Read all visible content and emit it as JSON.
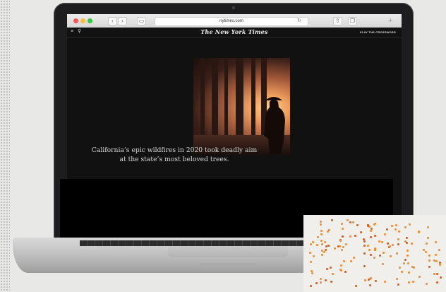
{
  "browser": {
    "url": "nytimes.com",
    "back_glyph": "‹",
    "forward_glyph": "›",
    "plus_glyph": "+",
    "reload_glyph": "↻"
  },
  "site": {
    "logo": "The New York Times",
    "right_link": "PLAY THE CROSSWORD",
    "menu_glyph": "≡",
    "search_glyph": "⚲"
  },
  "article": {
    "caption_line1": "California’s epic wildfires in 2020 took deadly aim",
    "caption_line2": "at the state’s most beloved trees."
  },
  "colors": {
    "traffic_red": "#fc5753",
    "traffic_yellow": "#fdbc40",
    "traffic_green": "#33c748",
    "map_dot": "#f08a2c"
  }
}
